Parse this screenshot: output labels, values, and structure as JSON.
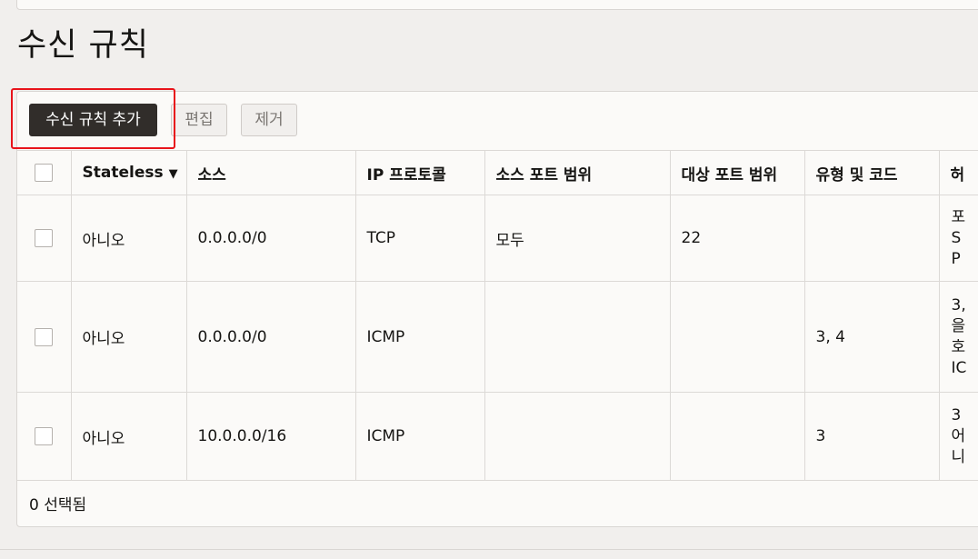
{
  "page": {
    "title": "수신 규칙"
  },
  "toolbar": {
    "add_label": "수신 규칙 추가",
    "edit_label": "편집",
    "remove_label": "제거"
  },
  "table": {
    "headers": {
      "stateless": "Stateless",
      "source": "소스",
      "protocol": "IP 프로토콜",
      "source_port": "소스 포트 범위",
      "dest_port": "대상 포트 범위",
      "type_code": "유형 및 코드",
      "description": "허"
    },
    "rows": [
      {
        "stateless": "아니오",
        "source": "0.0.0.0/0",
        "protocol": "TCP",
        "source_port": "모두",
        "dest_port": "22",
        "type_code": "",
        "description": [
          "포",
          "S",
          "P"
        ]
      },
      {
        "stateless": "아니오",
        "source": "0.0.0.0/0",
        "protocol": "ICMP",
        "source_port": "",
        "dest_port": "",
        "type_code": "3, 4",
        "description": [
          "3,",
          "을",
          "호",
          "IC"
        ]
      },
      {
        "stateless": "아니오",
        "source": "10.0.0.0/16",
        "protocol": "ICMP",
        "source_port": "",
        "dest_port": "",
        "type_code": "3",
        "description": [
          "3",
          "어",
          "니"
        ]
      }
    ]
  },
  "footer": {
    "selected_text": "0 선택됨"
  },
  "colors": {
    "primary_button": "#312d2a",
    "highlight": "#e8141b",
    "background": "#f1efed"
  }
}
